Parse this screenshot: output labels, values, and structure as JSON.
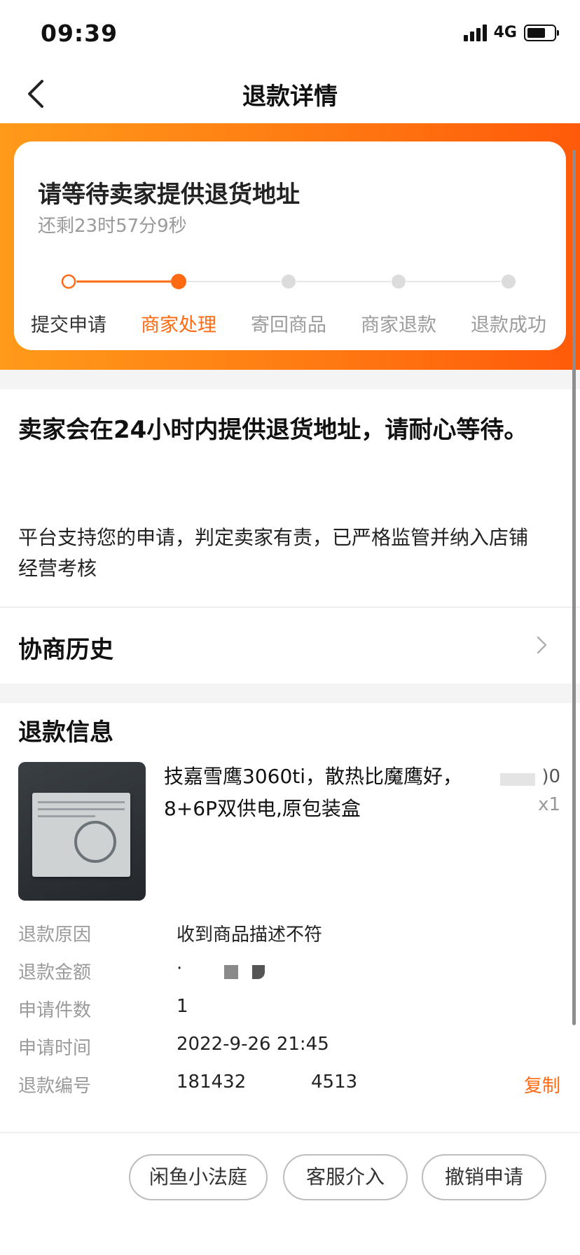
{
  "status_bar": {
    "time": "09:39",
    "network": "4G"
  },
  "nav": {
    "title": "退款详情"
  },
  "progress": {
    "title": "请等待卖家提供退货地址",
    "countdown": "还剩23时57分9秒",
    "steps": [
      {
        "label": "提交申请",
        "state": "done"
      },
      {
        "label": "商家处理",
        "state": "active"
      },
      {
        "label": "寄回商品",
        "state": "pending"
      },
      {
        "label": "商家退款",
        "state": "pending"
      },
      {
        "label": "退款成功",
        "state": "pending"
      }
    ],
    "colors": {
      "accent": "#ff6a12",
      "pending": "#dcdcdc"
    }
  },
  "message": {
    "main": "卖家会在24小时内提供退货地址，请耐心等待。",
    "sub": "平台支持您的申请，判定卖家有责，已严格监管并纳入店铺经营考核"
  },
  "history": {
    "label": "协商历史"
  },
  "refund_info": {
    "title": "退款信息",
    "product": {
      "name": "技嘉雪鹰3060ti，散热比魔鹰好，8+6P双供电,原包装盒",
      "price_fragment": ")0",
      "quantity": "x1"
    },
    "rows": {
      "reason": {
        "key": "退款原因",
        "value": "收到商品描述不符"
      },
      "amount": {
        "key": "退款金额",
        "value": "·"
      },
      "count": {
        "key": "申请件数",
        "value": "1"
      },
      "time": {
        "key": "申请时间",
        "value": "2022-9-26 21:45"
      },
      "number": {
        "key": "退款编号",
        "value_start": "181432",
        "value_end": "4513",
        "copy_label": "复制"
      }
    }
  },
  "actions": {
    "court": "闲鱼小法庭",
    "service": "客服介入",
    "cancel": "撤销申请"
  }
}
